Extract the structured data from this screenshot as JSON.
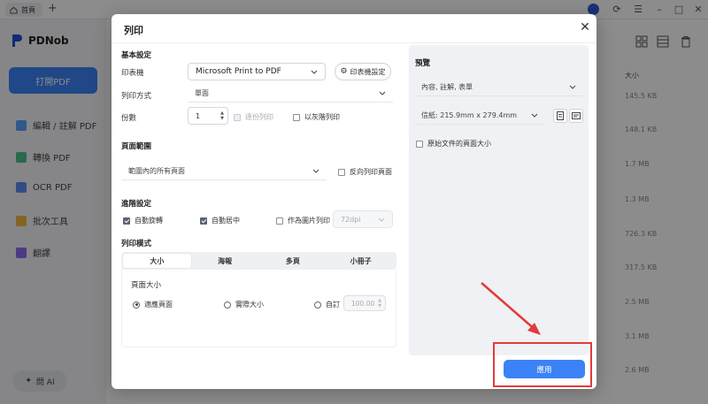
{
  "app": {
    "tab_label": "首頁",
    "new_tab": "+",
    "logo_text": "PDNob",
    "open_button": "打開PDF",
    "nav": [
      {
        "label": "編輯 / 註解 PDF"
      },
      {
        "label": "轉換 PDF"
      },
      {
        "label": "OCR PDF"
      },
      {
        "label": "批次工具"
      },
      {
        "label": "翻譯"
      }
    ],
    "ai_button": "問 AI",
    "size_header": "大小",
    "sizes": [
      "145.5 KB",
      "148.1 KB",
      "1.7 MB",
      "1.3 MB",
      "726.3 KB",
      "317.5 KB",
      "2.5 MB",
      "3.1 MB",
      "2.6 MB"
    ]
  },
  "dialog": {
    "title": "列印",
    "basic": {
      "heading": "基本設定",
      "printer_label": "印表機",
      "printer_value": "Microsoft Print to PDF",
      "printer_settings": "印表機設定",
      "method_label": "列印方式",
      "method_value": "單面",
      "copies_label": "份數",
      "copies_value": "1",
      "collate_label": "逐份列印",
      "grayscale_label": "以灰階列印"
    },
    "range": {
      "heading": "頁面範圍",
      "value": "範圍內的所有頁面",
      "reverse_label": "反向列印頁面"
    },
    "advanced": {
      "heading": "進階設定",
      "auto_rotate": "自動旋轉",
      "auto_center": "自動居中",
      "as_image": "作為圖片列印",
      "dpi": "72dpi"
    },
    "mode": {
      "heading": "列印模式",
      "tabs": [
        "大小",
        "海報",
        "多頁",
        "小冊子"
      ],
      "page_size_label": "頁面大小",
      "fit": "適應頁面",
      "actual": "實際大小",
      "custom": "自訂",
      "custom_value": "100.00"
    },
    "preview": {
      "heading": "預覽",
      "content_value": "內容, 註解, 表單",
      "paper_value": "信紙: 215.9mm x 279.4mm",
      "original_size_label": "原始文件的頁面大小"
    },
    "apply_button": "應用"
  },
  "colors": {
    "accent": "#3b82f6",
    "highlight": "#e33b3b"
  }
}
